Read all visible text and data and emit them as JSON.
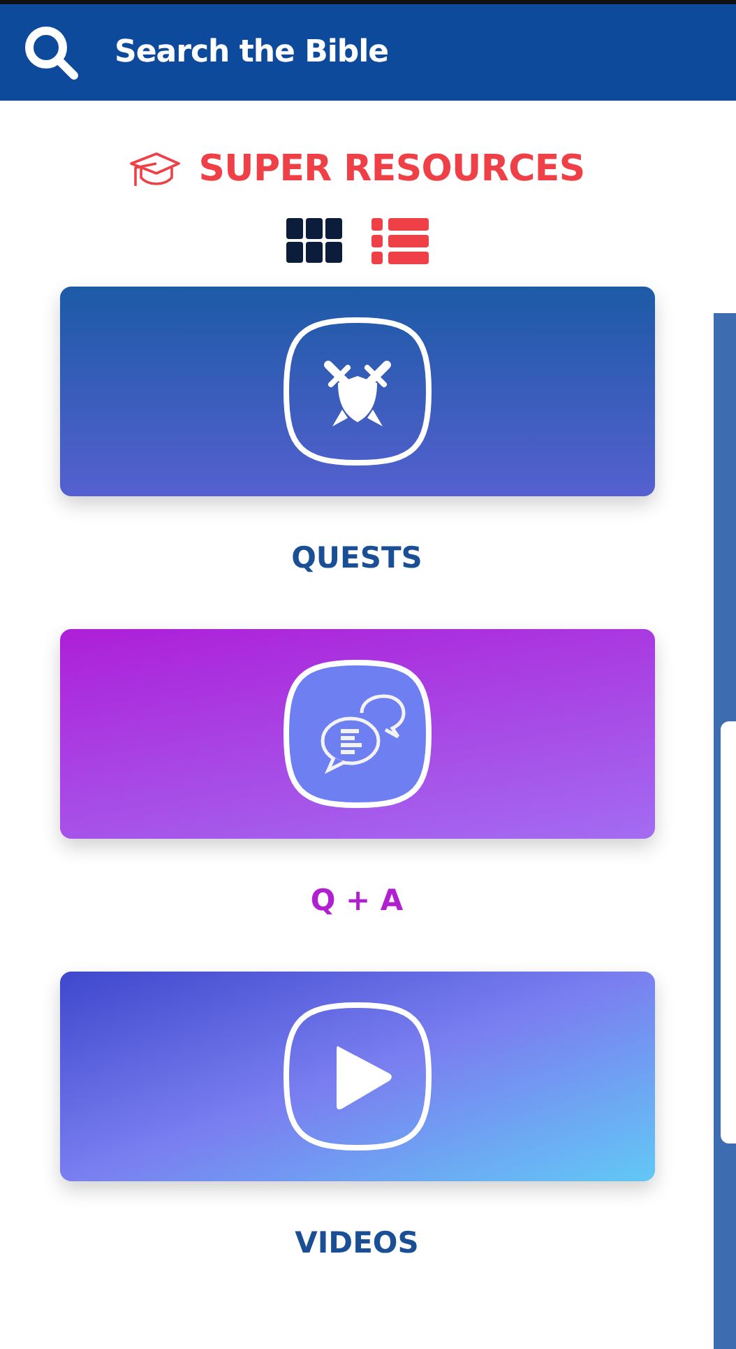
{
  "header": {
    "search_label": "Search the Bible"
  },
  "section": {
    "title": "SUPER RESOURCES"
  },
  "view_toggle": [
    {
      "kind": "grid",
      "selected": false
    },
    {
      "kind": "list",
      "selected": true
    }
  ],
  "resources": [
    {
      "kind": "quests",
      "label": "QUESTS"
    },
    {
      "kind": "qa",
      "label": "Q + A"
    },
    {
      "kind": "videos",
      "label": "VIDEOS"
    }
  ]
}
